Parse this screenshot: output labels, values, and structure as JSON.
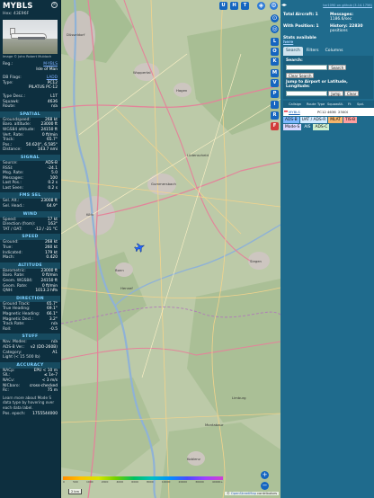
{
  "aircraft": {
    "callsign": "MYBLS",
    "hex_line": "Hex: 43E96F",
    "photo_credit": "Image © John Robert Muldoch",
    "reg_label": "Reg.:",
    "reg_value": "M-YBLS",
    "country": "Isle of Man",
    "db_flags_label": "DB Flags:",
    "db_flags_value": "LADD",
    "type_label": "Type:",
    "type_value": "PC12",
    "model": "PILATUS PC-12",
    "type_desc_label": "Type Desc.:",
    "type_desc_value": "L1T",
    "squawk_label": "Squawk:",
    "squawk_value": "4636",
    "route_label": "Route:",
    "route_value": "n/a"
  },
  "sections": {
    "spatial": "SPATIAL",
    "signal": "SIGNAL",
    "fms_sel": "FMS SEL",
    "wind": "WIND",
    "speed": "SPEED",
    "altitude": "ALTITUDE",
    "direction": "DIRECTION",
    "stuff": "STUFF",
    "accuracy": "ACCURACY"
  },
  "spatial": [
    {
      "k": "Groundspeed:",
      "v": "268 kt"
    },
    {
      "k": "Baro. altitude:",
      "v": "23000 ft"
    },
    {
      "k": "WGS84 altitude:",
      "v": "24150 ft"
    },
    {
      "k": "Vert. Rate:",
      "v": "0 ft/min"
    },
    {
      "k": "Track:",
      "v": "65.7°"
    },
    {
      "k": "Pos.:",
      "v": "50.620°, 6.585°"
    },
    {
      "k": "Distance:",
      "v": "143.7 nmi"
    }
  ],
  "signal": [
    {
      "k": "Source:",
      "v": "ADS-B"
    },
    {
      "k": "RSSI:",
      "v": "-24.1"
    },
    {
      "k": "Msg. Rate:",
      "v": "5.0"
    },
    {
      "k": "Messages:",
      "v": "100"
    },
    {
      "k": "Last Pos.:",
      "v": "0.2 s"
    },
    {
      "k": "Last Seen:",
      "v": "0.2 s"
    }
  ],
  "fms_sel": [
    {
      "k": "Sel. Alt.:",
      "v": "23008 ft"
    },
    {
      "k": "Sel. Head.:",
      "v": "64.9°"
    }
  ],
  "wind": [
    {
      "k": "Speed:",
      "v": "17 kt"
    },
    {
      "k": "Direction (from):",
      "v": "163°"
    },
    {
      "k": "TAT / OAT:",
      "v": "-12 / -21 °C"
    }
  ],
  "speed": [
    {
      "k": "Ground:",
      "v": "268 kt"
    },
    {
      "k": "True:",
      "v": "260 kt"
    },
    {
      "k": "Indicated:",
      "v": "179 kt"
    },
    {
      "k": "Mach:",
      "v": "0.420"
    }
  ],
  "altitude": [
    {
      "k": "Barometric:",
      "v": "23000 ft"
    },
    {
      "k": "Baro. Rate:",
      "v": "0 ft/min"
    },
    {
      "k": "Geom. WGS84:",
      "v": "24150 ft"
    },
    {
      "k": "Geom. Rate:",
      "v": "0 ft/min"
    },
    {
      "k": "QNH:",
      "v": "1013.3 hPa"
    }
  ],
  "direction": [
    {
      "k": "Ground Track:",
      "v": "65.7°"
    },
    {
      "k": "True Heading:",
      "v": "69.1°"
    },
    {
      "k": "Magnetic Heading:",
      "v": "66.1°"
    },
    {
      "k": "Magnetic Decl.:",
      "v": "3.2°"
    },
    {
      "k": "Track Rate:",
      "v": "n/a"
    },
    {
      "k": "Roll:",
      "v": "-0.5"
    }
  ],
  "stuff": [
    {
      "k": "Nav. Modes:",
      "v": "n/a"
    },
    {
      "k": "ADS-B Ver.:",
      "v": "v2 (DO-260B)"
    },
    {
      "k": "Category:",
      "v": "A1"
    },
    {
      "k": "Light (< 15 500 lb)",
      "v": ""
    }
  ],
  "accuracy": [
    {
      "k": "NACp:",
      "v": "EPU < 10 m"
    },
    {
      "k": "SIL:",
      "v": "≤ 1e-7"
    },
    {
      "k": "NACv:",
      "v": "< 3 m/s"
    },
    {
      "k": "NICbaro:",
      "v": "cross-checked"
    },
    {
      "k": "Rc:",
      "v": "75 m"
    }
  ],
  "accuracy_note": "Learn more about Mode S data type by hovering over each data label.",
  "pos_epoch_label": "Pos. epoch:",
  "pos_epoch_value": "1755544000",
  "map": {
    "top_buttons": [
      "U",
      "H",
      "T"
    ],
    "side_buttons": [
      "L",
      "O",
      "K",
      "M",
      "P",
      "I",
      "R"
    ],
    "city_labels": [
      "Düsseldorf",
      "Köln",
      "Bonn",
      "Siegen",
      "Limburg",
      "Koblenz",
      "Montabaur",
      "Wuppertal",
      "Hagen",
      "Lüdenscheid",
      "Gummersbach",
      "Hennef"
    ],
    "legend_labels": [
      "0",
      "500",
      "1000",
      "2000",
      "4000",
      "6000",
      "8000",
      "10000",
      "20000",
      "30000",
      "40000+"
    ],
    "scale": "2 km",
    "attribution_prefix": "© ",
    "attribution_link": "OpenStreetMap",
    "attribution_suffix": " contributors",
    "zoom_in": "+",
    "zoom_out": "−"
  },
  "sidebar": {
    "version_link": "tar1090 on github (3.14.1756)",
    "total_aircraft": "Total Aircraft: 1",
    "with_position": "With Position: 1",
    "messages_label": "Messages:",
    "messages_value": "1186.6/sec",
    "history_label": "History: 22830",
    "history_sub": "positions",
    "stats_available": "Stats available",
    "stats_link": "here",
    "tabs": [
      "Search",
      "Filters",
      "Columns"
    ],
    "search_label": "Search:",
    "search_button": "Search",
    "clear_search": "Clear Search",
    "jump_label": "Jump to Airport or Latitude, Longitude:",
    "jump_button": "Jump",
    "clear_button": "Clear",
    "columns": [
      "",
      "Callsign",
      "Route",
      "Type",
      "Squawk",
      "Alt.",
      "Ft",
      "Spd."
    ],
    "row": {
      "callsign": "MYBLS",
      "type": "PC12",
      "squawk": "4636",
      "alt": "23000"
    },
    "sources": [
      {
        "label": "ADS-B",
        "color": "#7fb8ff"
      },
      {
        "label": "UAT / ADS-R",
        "color": "#cfe9ff"
      },
      {
        "label": "MLAT",
        "color": "#f6b46b"
      },
      {
        "label": "TIS-B",
        "color": "#ff9f9f"
      },
      {
        "label": "Mode-S",
        "color": "#d7d7ff"
      },
      {
        "label": "AIS",
        "color": "#1f6b8d"
      },
      {
        "label": "ADS-C",
        "color": "#cdeecf"
      }
    ]
  }
}
